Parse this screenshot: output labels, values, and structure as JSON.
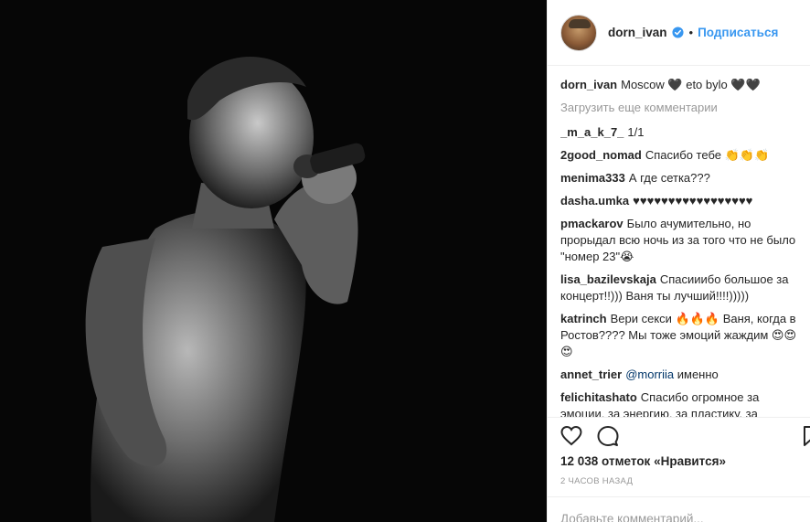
{
  "post": {
    "author": "dorn_ivan",
    "follow_label": "Подписаться",
    "dot": "•"
  },
  "caption": {
    "user": "dorn_ivan",
    "text": "Moscow 🖤 eto bylo 🖤🖤"
  },
  "load_more": "Загрузить еще комментарии",
  "comments": [
    {
      "user": "_m_a_k_7_",
      "text": "1/1"
    },
    {
      "user": "2good_nomad",
      "text": "Спасибо тебе 👏👏👏"
    },
    {
      "user": "menima333",
      "text": "А где сетка???"
    },
    {
      "user": "dasha.umka",
      "text": "♥♥♥♥♥♥♥♥♥♥♥♥♥♥♥♥♥"
    },
    {
      "user": "pmackarov",
      "text": "Было ачумительно, но прорыдал всю ночь из за того что не было \"номер 23\"😭"
    },
    {
      "user": "lisa_bazilevskaja",
      "text": "Спасииибо большое за концерт!!))) Ваня ты лучший!!!!)))))"
    },
    {
      "user": "katrinch",
      "text": "Вери секси 🔥🔥🔥 Ваня, когда в Ростов???? Мы тоже эмоций жаждим 😍😍😍"
    },
    {
      "user": "annet_trier",
      "mention": "@morriia",
      "text": "именно"
    },
    {
      "user": "felichitashato",
      "text": "Спасибо огромное за эмоции, за энергию, за пластику, за"
    }
  ],
  "likes": "12 038 отметок «Нравится»",
  "time": "2 ЧАСОВ НАЗАД",
  "add_comment_placeholder": "Добавьте комментарий...",
  "icons": [
    "heart-icon",
    "comment-icon",
    "bookmark-icon",
    "verified-badge-icon"
  ],
  "colors": {
    "link": "#3897f0",
    "text": "#262626",
    "muted": "#999999",
    "badge": "#3897f0"
  }
}
